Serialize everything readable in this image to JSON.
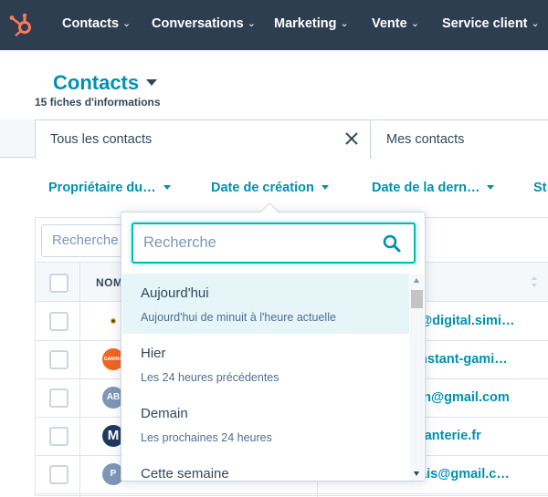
{
  "colors": {
    "nav_bg": "#2d3e50",
    "brand_orange": "#ff7a59",
    "link_teal": "#0091ae",
    "focus_teal": "#00bda5"
  },
  "topnav": {
    "items": [
      {
        "label": "Contacts"
      },
      {
        "label": "Conversations"
      },
      {
        "label": "Marketing"
      },
      {
        "label": "Vente"
      },
      {
        "label": "Service client"
      }
    ],
    "chevron": "⌄"
  },
  "page": {
    "title": "Contacts",
    "record_count": "15 fiches d'informations"
  },
  "views": {
    "active": "Tous les contacts",
    "other": "Mes contacts"
  },
  "filters": [
    {
      "label": "Propriétaire du…"
    },
    {
      "label": "Date de création"
    },
    {
      "label": "Date de la dern…"
    },
    {
      "label": "St"
    }
  ],
  "table": {
    "search_placeholder": "Recherche",
    "name_header": "NOM",
    "rows": [
      {
        "avatar": "",
        "avatar_color": "#ffffff",
        "email": "y@digital.simi…"
      },
      {
        "avatar": "GAMING",
        "avatar_color": "#f26522",
        "email": ".instant-gami…"
      },
      {
        "avatar": "AB",
        "avatar_color": "#7c98b6",
        "email": "ien@gmail.com"
      },
      {
        "avatar": "M",
        "avatar_color": "#1f3a5f",
        "email": "rkanterie.fr"
      },
      {
        "avatar": "P",
        "avatar_color": "#7c98b6",
        "email": "vais@gmail.c…"
      }
    ]
  },
  "dropdown": {
    "search_placeholder": "Recherche",
    "options": [
      {
        "label": "Aujourd'hui",
        "desc": "Aujourd'hui de minuit à l'heure actuelle"
      },
      {
        "label": "Hier",
        "desc": "Les 24 heures précédentes"
      },
      {
        "label": "Demain",
        "desc": "Les prochaines 24 heures"
      },
      {
        "label": "Cette semaine",
        "desc": ""
      }
    ]
  }
}
